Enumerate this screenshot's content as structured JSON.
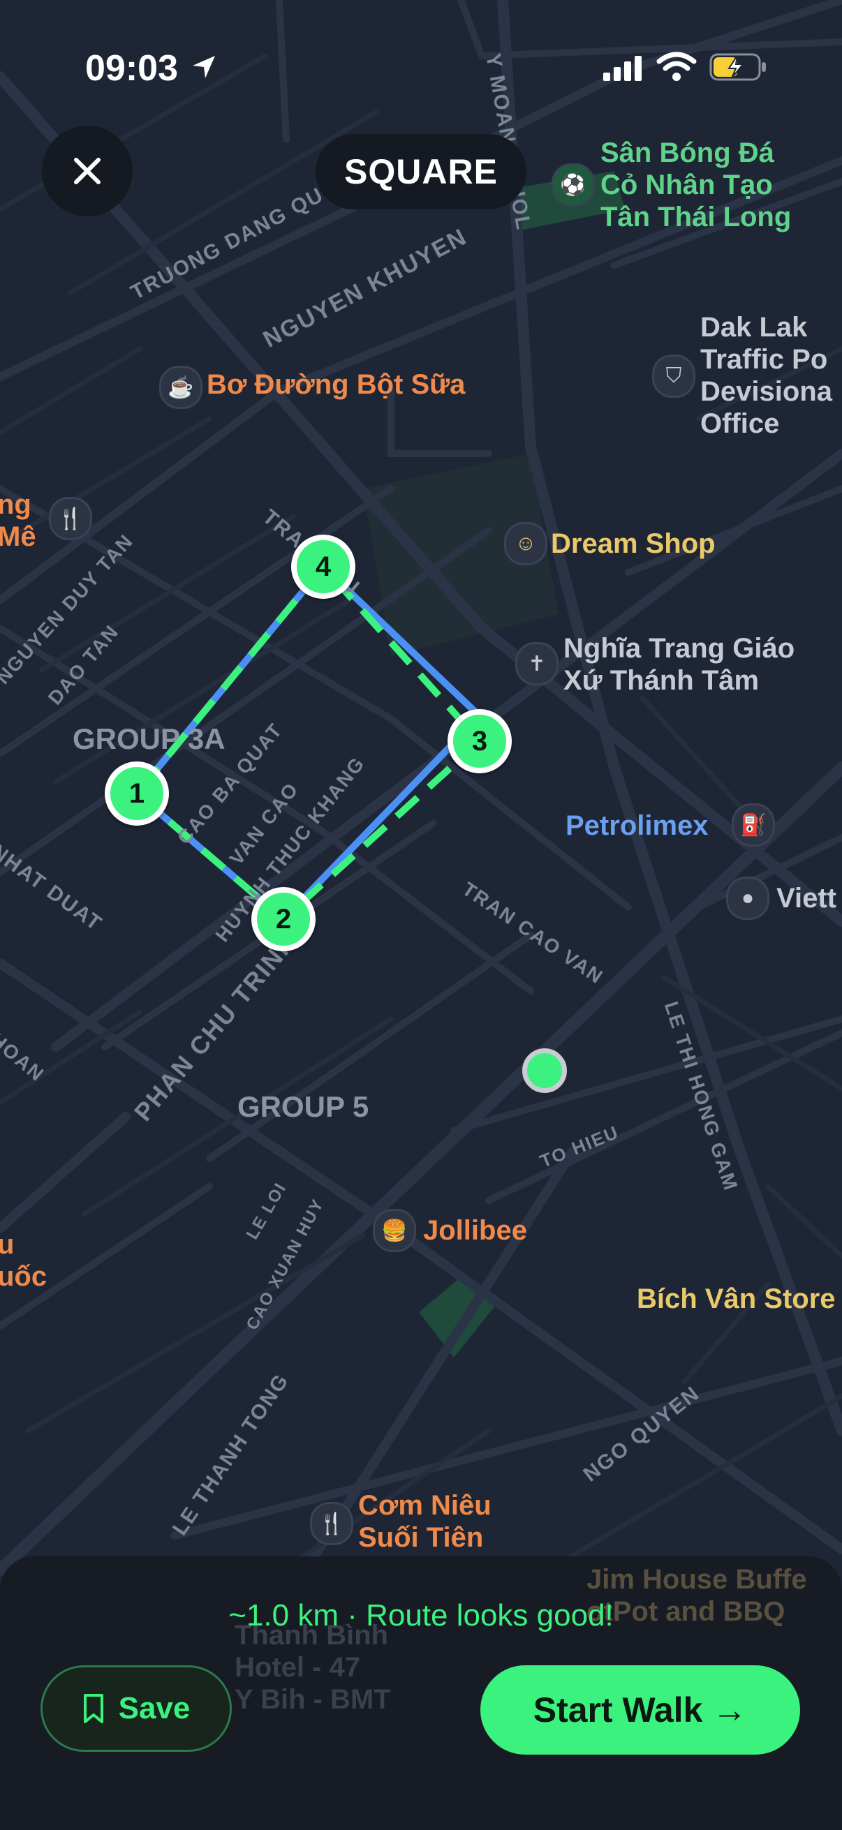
{
  "status_bar": {
    "time": "09:03"
  },
  "header": {
    "shape_label": "SQUARE"
  },
  "map": {
    "pois": [
      {
        "name": "Sân Bóng Đá Cỏ Nhân Tạo Tân Thái Long",
        "lines": [
          "Sân Bóng Đá",
          "Cỏ Nhân Tạo",
          "Tân Thái Long"
        ],
        "icon": "soccer-icon",
        "color": "#5fd38a"
      },
      {
        "name": "Bơ Đường Bột Sữa",
        "icon": "coffee-icon",
        "color": "#f08a4b"
      },
      {
        "name": "Dak Lak Traffic Police Division Office",
        "lines": [
          "Dak Lak",
          "Traffic Po",
          "Devisiona",
          "Office"
        ],
        "icon": "police-icon",
        "color": "#c6cbd3"
      },
      {
        "name": "Dream Shop",
        "icon": "robot-icon",
        "color": "#e9c96a"
      },
      {
        "name": "Nghĩa Trang Giáo Xứ Thánh Tâm",
        "lines": [
          "Nghĩa Trang Giáo",
          "Xứ Thánh Tâm"
        ],
        "icon": "cemetery-icon",
        "color": "#c6cbd3"
      },
      {
        "name": "Petrolimex",
        "icon": "fuel-icon",
        "color": "#6b9ff0"
      },
      {
        "name": "Viett",
        "icon": "place-icon",
        "color": "#c6cbd3"
      },
      {
        "name": "Jollibee",
        "icon": "fastfood-icon",
        "color": "#f08a4b"
      },
      {
        "name": "Bích Vân Store",
        "icon": "store-icon",
        "color": "#e9c96a"
      },
      {
        "name": "Cơm Niêu Suối Tiên",
        "lines": [
          "Cơm Niêu",
          "Suối Tiên"
        ],
        "icon": "restaurant-icon",
        "color": "#f08a4b"
      },
      {
        "name": "ng Mê",
        "lines": [
          "ng",
          "Mê"
        ],
        "icon": "restaurant-icon",
        "color": "#f08a4b"
      },
      {
        "name": "u uốc",
        "lines": [
          "u",
          "uốc"
        ],
        "color": "#f08a4b"
      },
      {
        "name": "Jim House Buffet HotPot and BBQ",
        "lines": [
          "Jim House Buffe",
          "otPot and BBQ"
        ],
        "color": "#7a6a55"
      },
      {
        "name": "Thanh Bình Hotel - 47 Y Bih - BMT",
        "lines": [
          "Thanh Bình",
          "Hotel - 47",
          "Y Bih - BMT"
        ],
        "color": "#5c6372"
      }
    ],
    "areas": [
      "GROUP 3A",
      "GROUP 5"
    ],
    "roads": [
      "TRUONG DANG QUE",
      "NGUYEN KHUYEN",
      "Y MOAN ENUOL",
      "TRAN PHU",
      "NGUYEN DUY TAN",
      "DAO TAN",
      "CAO BA QUAT",
      "VAN CAO",
      "HUYNH THUC KHANG",
      "NHAT DUAT",
      "PHAN CHU TRINH",
      "TRAN CAO VAN",
      "LE THI HONG GAM",
      "TO HIEU",
      "LE LOI",
      "CAO XUAN HUY",
      "LE THANH TONG",
      "NGO QUYEN",
      "HOAN"
    ],
    "waypoints": [
      "1",
      "2",
      "3",
      "4"
    ]
  },
  "sheet": {
    "summary": "~1.0 km · Route looks good!",
    "save_label": "Save",
    "start_label": "Start Walk →"
  },
  "colors": {
    "accent": "#3cf27f",
    "route_blue": "#4a90f5",
    "background": "#1e2635"
  }
}
